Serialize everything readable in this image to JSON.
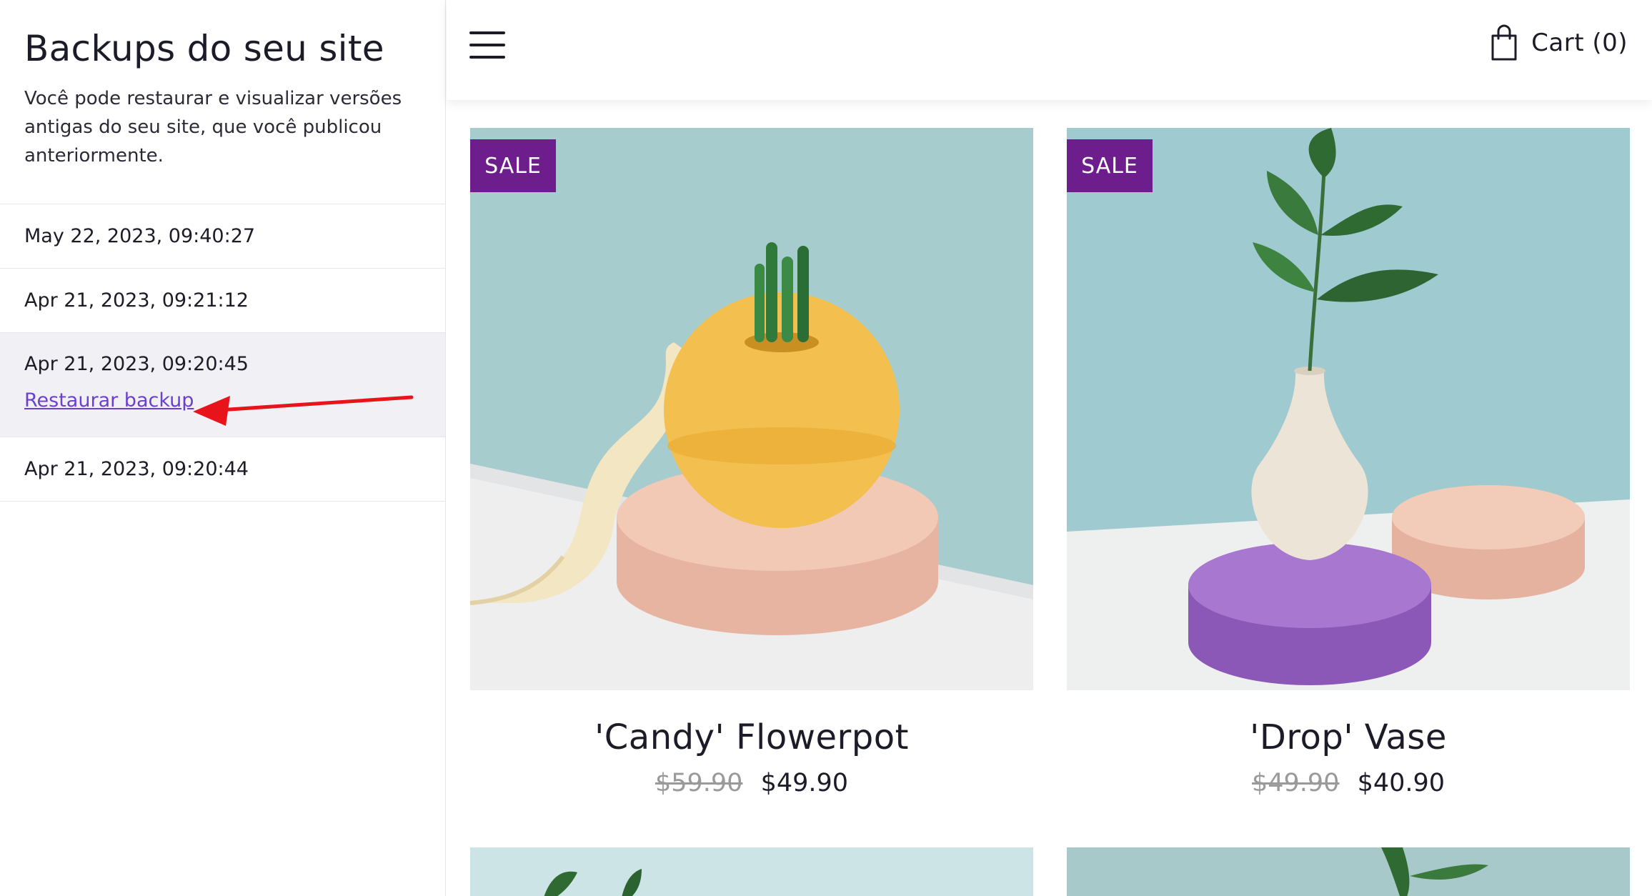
{
  "sidebar": {
    "title": "Backups do seu site",
    "description": "Você pode restaurar e visualizar versões antigas do seu site, que você publicou anteriormente.",
    "backups": [
      {
        "timestamp": "May 22, 2023, 09:40:27"
      },
      {
        "timestamp": "Apr 21, 2023, 09:21:12"
      },
      {
        "timestamp": "Apr 21, 2023, 09:20:45",
        "action": "Restaurar backup"
      },
      {
        "timestamp": "Apr 21, 2023, 09:20:44"
      }
    ]
  },
  "header": {
    "menu_icon": "hamburger-menu-icon",
    "cart_icon": "shopping-bag-icon",
    "cart_label": "Cart (0)"
  },
  "products": [
    {
      "badge": "SALE",
      "name": "'Candy' Flowerpot",
      "old_price": "$59.90",
      "price": "$49.90"
    },
    {
      "badge": "SALE",
      "name": "'Drop' Vase",
      "old_price": "$49.90",
      "price": "$40.90"
    }
  ],
  "colors": {
    "sale_badge": "#6d1e8c",
    "link": "#6b3fd4",
    "annotation_arrow": "#e8141b",
    "active_row": "#f1f1f5"
  }
}
